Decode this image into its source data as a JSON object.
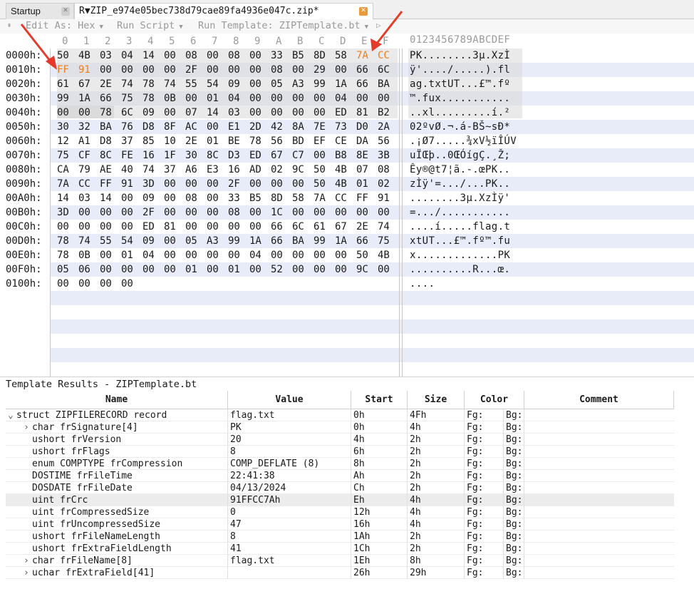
{
  "tabs": {
    "startup": "Startup",
    "file": "R▼ZIP_e974e05bec738d79cae89fa4936e047c.zip*"
  },
  "toolbar": {
    "edit_as": "Edit As: Hex",
    "run_script": "Run Script",
    "run_template": "Run Template: ZIPTemplate.bt"
  },
  "hex": {
    "column_headers": [
      "0",
      "1",
      "2",
      "3",
      "4",
      "5",
      "6",
      "7",
      "8",
      "9",
      "A",
      "B",
      "C",
      "D",
      "E",
      "F"
    ],
    "ascii_header": "0123456789ABCDEF",
    "rows": [
      {
        "addr": "0000h:",
        "bytes": [
          "50",
          "4B",
          "03",
          "04",
          "14",
          "00",
          "08",
          "00",
          "08",
          "00",
          "33",
          "B5",
          "8D",
          "58",
          "7A",
          "CC"
        ],
        "ascii": "PK........3µ.XzÌ"
      },
      {
        "addr": "0010h:",
        "bytes": [
          "FF",
          "91",
          "00",
          "00",
          "00",
          "00",
          "2F",
          "00",
          "00",
          "00",
          "08",
          "00",
          "29",
          "00",
          "66",
          "6C"
        ],
        "ascii": "ÿ'..../.....).fl"
      },
      {
        "addr": "0020h:",
        "bytes": [
          "61",
          "67",
          "2E",
          "74",
          "78",
          "74",
          "55",
          "54",
          "09",
          "00",
          "05",
          "A3",
          "99",
          "1A",
          "66",
          "BA"
        ],
        "ascii": "ag.txtUT...£™.fº"
      },
      {
        "addr": "0030h:",
        "bytes": [
          "99",
          "1A",
          "66",
          "75",
          "78",
          "0B",
          "00",
          "01",
          "04",
          "00",
          "00",
          "00",
          "00",
          "04",
          "00",
          "00"
        ],
        "ascii": "™.fux..........."
      },
      {
        "addr": "0040h:",
        "bytes": [
          "00",
          "00",
          "78",
          "6C",
          "09",
          "00",
          "07",
          "14",
          "03",
          "00",
          "00",
          "00",
          "00",
          "ED",
          "81",
          "B2"
        ],
        "ascii": "..xl.........í.²"
      },
      {
        "addr": "0050h:",
        "bytes": [
          "30",
          "32",
          "BA",
          "76",
          "D8",
          "8F",
          "AC",
          "00",
          "E1",
          "2D",
          "42",
          "8A",
          "7E",
          "73",
          "D0",
          "2A"
        ],
        "ascii": "02ºvØ.¬.á-BŠ~sÐ*"
      },
      {
        "addr": "0060h:",
        "bytes": [
          "12",
          "A1",
          "D8",
          "37",
          "85",
          "10",
          "2E",
          "01",
          "BE",
          "78",
          "56",
          "BD",
          "EF",
          "CE",
          "DA",
          "56"
        ],
        "ascii": ".¡Ø7.....¾xV½ïÎÚV"
      },
      {
        "addr": "0070h:",
        "bytes": [
          "75",
          "CF",
          "8C",
          "FE",
          "16",
          "1F",
          "30",
          "8C",
          "D3",
          "ED",
          "67",
          "C7",
          "00",
          "B8",
          "8E",
          "3B"
        ],
        "ascii": "uÏŒþ..0ŒÓígÇ.¸Ž;"
      },
      {
        "addr": "0080h:",
        "bytes": [
          "CA",
          "79",
          "AE",
          "40",
          "74",
          "37",
          "A6",
          "E3",
          "16",
          "AD",
          "02",
          "9C",
          "50",
          "4B",
          "07",
          "08"
        ],
        "ascii": "Êy®@t7¦ã.-.œPK.."
      },
      {
        "addr": "0090h:",
        "bytes": [
          "7A",
          "CC",
          "FF",
          "91",
          "3D",
          "00",
          "00",
          "00",
          "2F",
          "00",
          "00",
          "00",
          "50",
          "4B",
          "01",
          "02"
        ],
        "ascii": "zÌÿ'=.../...PK.."
      },
      {
        "addr": "00A0h:",
        "bytes": [
          "14",
          "03",
          "14",
          "00",
          "09",
          "00",
          "08",
          "00",
          "33",
          "B5",
          "8D",
          "58",
          "7A",
          "CC",
          "FF",
          "91"
        ],
        "ascii": "........3µ.XzÌÿ'"
      },
      {
        "addr": "00B0h:",
        "bytes": [
          "3D",
          "00",
          "00",
          "00",
          "2F",
          "00",
          "00",
          "00",
          "08",
          "00",
          "1C",
          "00",
          "00",
          "00",
          "00",
          "00"
        ],
        "ascii": "=.../..........."
      },
      {
        "addr": "00C0h:",
        "bytes": [
          "00",
          "00",
          "00",
          "00",
          "ED",
          "81",
          "00",
          "00",
          "00",
          "00",
          "66",
          "6C",
          "61",
          "67",
          "2E",
          "74"
        ],
        "ascii": "....í.....flag.t"
      },
      {
        "addr": "00D0h:",
        "bytes": [
          "78",
          "74",
          "55",
          "54",
          "09",
          "00",
          "05",
          "A3",
          "99",
          "1A",
          "66",
          "BA",
          "99",
          "1A",
          "66",
          "75"
        ],
        "ascii": "xtUT...£™.fº™.fu"
      },
      {
        "addr": "00E0h:",
        "bytes": [
          "78",
          "0B",
          "00",
          "01",
          "04",
          "00",
          "00",
          "00",
          "00",
          "04",
          "00",
          "00",
          "00",
          "00",
          "50",
          "4B"
        ],
        "ascii": "x.............PK"
      },
      {
        "addr": "00F0h:",
        "bytes": [
          "05",
          "06",
          "00",
          "00",
          "00",
          "00",
          "01",
          "00",
          "01",
          "00",
          "52",
          "00",
          "00",
          "00",
          "9C",
          "00"
        ],
        "ascii": "..........R...œ."
      },
      {
        "addr": "0100h:",
        "bytes": [
          "00",
          "00",
          "00",
          "00"
        ],
        "ascii": "...."
      }
    ]
  },
  "template_results": {
    "title": "Template Results - ZIPTemplate.bt",
    "headers": {
      "name": "Name",
      "value": "Value",
      "start": "Start",
      "size": "Size",
      "color": "Color",
      "comment": "Comment"
    },
    "rows": [
      {
        "expander": "⌄",
        "name": "struct ZIPFILERECORD record",
        "value": "flag.txt",
        "start": "0h",
        "size": "4Fh",
        "fg": "Fg:",
        "bg": "Bg:"
      },
      {
        "expander": "›",
        "name": "char frSignature[4]",
        "value": "PK",
        "start": "0h",
        "size": "4h",
        "fg": "Fg:",
        "bg": "Bg:"
      },
      {
        "expander": "",
        "name": "ushort frVersion",
        "value": "20",
        "start": "4h",
        "size": "2h",
        "fg": "Fg:",
        "bg": "Bg:"
      },
      {
        "expander": "",
        "name": "ushort frFlags",
        "value": "8",
        "start": "6h",
        "size": "2h",
        "fg": "Fg:",
        "bg": "Bg:"
      },
      {
        "expander": "",
        "name": "enum COMPTYPE frCompression",
        "value": "COMP_DEFLATE (8)",
        "start": "8h",
        "size": "2h",
        "fg": "Fg:",
        "bg": "Bg:"
      },
      {
        "expander": "",
        "name": "DOSTIME frFileTime",
        "value": "22:41:38",
        "start": "Ah",
        "size": "2h",
        "fg": "Fg:",
        "bg": "Bg:"
      },
      {
        "expander": "",
        "name": "DOSDATE frFileDate",
        "value": "04/13/2024",
        "start": "Ch",
        "size": "2h",
        "fg": "Fg:",
        "bg": "Bg:"
      },
      {
        "expander": "",
        "name": "uint frCrc",
        "value": "91FFCC7Ah",
        "start": "Eh",
        "size": "4h",
        "fg": "Fg:",
        "bg": "Bg:"
      },
      {
        "expander": "",
        "name": "uint frCompressedSize",
        "value": "0",
        "start": "12h",
        "size": "4h",
        "fg": "Fg:",
        "bg": "Bg:"
      },
      {
        "expander": "",
        "name": "uint frUncompressedSize",
        "value": "47",
        "start": "16h",
        "size": "4h",
        "fg": "Fg:",
        "bg": "Bg:"
      },
      {
        "expander": "",
        "name": "ushort frFileNameLength",
        "value": "8",
        "start": "1Ah",
        "size": "2h",
        "fg": "Fg:",
        "bg": "Bg:"
      },
      {
        "expander": "",
        "name": "ushort frExtraFieldLength",
        "value": "41",
        "start": "1Ch",
        "size": "2h",
        "fg": "Fg:",
        "bg": "Bg:"
      },
      {
        "expander": "›",
        "name": "char frFileName[8]",
        "value": "flag.txt",
        "start": "1Eh",
        "size": "8h",
        "fg": "Fg:",
        "bg": "Bg:"
      },
      {
        "expander": "›",
        "name": "uchar frExtraField[41]",
        "value": "",
        "start": "26h",
        "size": "29h",
        "fg": "Fg:",
        "bg": "Bg:"
      }
    ]
  },
  "colors": {
    "highlight": "#f07c1b",
    "band": "#e8ecf8",
    "selection": "#d3d3d3",
    "arrow": "#e53a2a"
  }
}
